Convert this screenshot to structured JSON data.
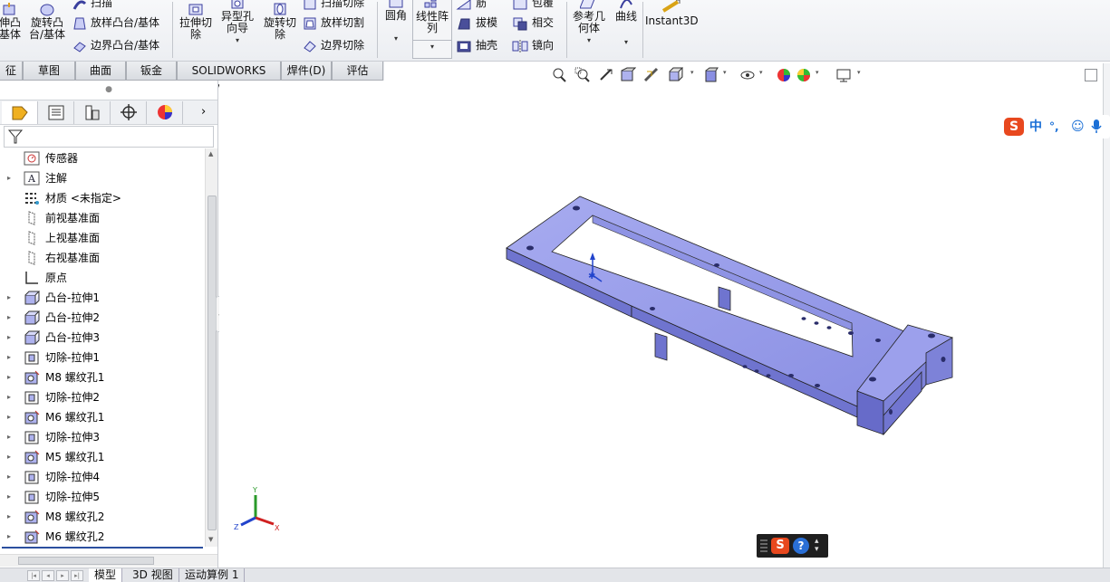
{
  "ribbon": {
    "col1": [
      "伸凸",
      "基体"
    ],
    "col2": [
      "旋转凸",
      "台/基体"
    ],
    "sweep": "扫描",
    "loft": "放样凸台/基体",
    "boundary": "边界凸台/基体",
    "extrude_cut": [
      "拉伸切",
      "除"
    ],
    "hole_wizard": [
      "异型孔",
      "向导"
    ],
    "revolve_cut": [
      "旋转切",
      "除"
    ],
    "sweep_cut": "扫描切除",
    "loft_cut": "放样切割",
    "boundary_cut": "边界切除",
    "fillet": "圆角",
    "linear_pattern": [
      "线性阵",
      "列"
    ],
    "rib": "筋",
    "draft": "拔模",
    "shell": "抽壳",
    "wrap": "包覆",
    "intersect": "相交",
    "mirror": "镜向",
    "ref_geometry": [
      "参考几",
      "何体"
    ],
    "curves": "曲线",
    "instant3d": "Instant3D"
  },
  "tabs": [
    "征",
    "草图",
    "曲面",
    "钣金",
    "SOLIDWORKS MBD",
    "焊件(D)",
    "评估"
  ],
  "tree": [
    {
      "label": "传感器",
      "expandable": false,
      "icon": "sensor-icon"
    },
    {
      "label": "注解",
      "expandable": true,
      "icon": "annotation-icon"
    },
    {
      "label": "材质 <未指定>",
      "expandable": false,
      "icon": "material-icon"
    },
    {
      "label": "前视基准面",
      "expandable": false,
      "icon": "plane-icon"
    },
    {
      "label": "上视基准面",
      "expandable": false,
      "icon": "plane-icon"
    },
    {
      "label": "右视基准面",
      "expandable": false,
      "icon": "plane-icon"
    },
    {
      "label": "原点",
      "expandable": false,
      "icon": "origin-icon"
    },
    {
      "label": "凸台-拉伸1",
      "expandable": true,
      "icon": "boss-extrude-icon"
    },
    {
      "label": "凸台-拉伸2",
      "expandable": true,
      "icon": "boss-extrude-icon"
    },
    {
      "label": "凸台-拉伸3",
      "expandable": true,
      "icon": "boss-extrude-icon"
    },
    {
      "label": "切除-拉伸1",
      "expandable": true,
      "icon": "cut-extrude-icon"
    },
    {
      "label": "M8 螺纹孔1",
      "expandable": true,
      "icon": "thread-hole-icon"
    },
    {
      "label": "切除-拉伸2",
      "expandable": true,
      "icon": "cut-extrude-icon"
    },
    {
      "label": "M6 螺纹孔1",
      "expandable": true,
      "icon": "thread-hole-icon"
    },
    {
      "label": "切除-拉伸3",
      "expandable": true,
      "icon": "cut-extrude-icon"
    },
    {
      "label": "M5 螺纹孔1",
      "expandable": true,
      "icon": "thread-hole-icon"
    },
    {
      "label": "切除-拉伸4",
      "expandable": true,
      "icon": "cut-extrude-icon"
    },
    {
      "label": "切除-拉伸5",
      "expandable": true,
      "icon": "cut-extrude-icon"
    },
    {
      "label": "M8 螺纹孔2",
      "expandable": true,
      "icon": "thread-hole-icon"
    },
    {
      "label": "M6 螺纹孔2",
      "expandable": true,
      "icon": "thread-hole-icon"
    }
  ],
  "bottom_tabs": [
    "模型",
    "3D 视图",
    "运动算例 1"
  ],
  "ime": {
    "cn": "中",
    "punct": "°,",
    "emoji": "☺",
    "mic": "🎤"
  },
  "triad": {
    "x": "X",
    "y": "Y",
    "z": "Z"
  },
  "colors": {
    "part": "#8f93e6",
    "part_dark": "#5a5ec0",
    "part_light": "#b9bcf4",
    "accent": "#2b4f9f"
  }
}
